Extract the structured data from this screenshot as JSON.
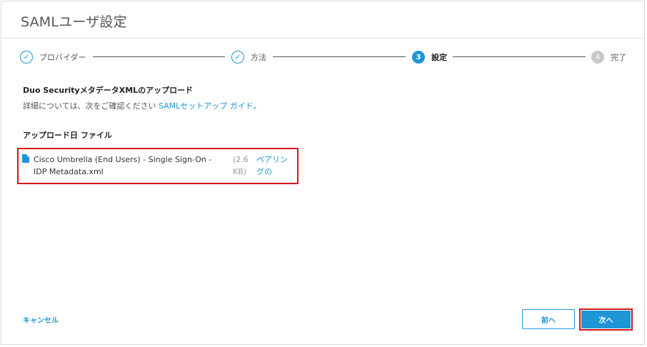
{
  "dialog": {
    "title": "SAMLユーザ設定"
  },
  "stepper": {
    "steps": [
      {
        "label": "プロバイダー",
        "state": "done",
        "marker": "✓"
      },
      {
        "label": "方法",
        "state": "done",
        "marker": "✓"
      },
      {
        "label": "設定",
        "state": "active",
        "marker": "3"
      },
      {
        "label": "完了",
        "state": "todo",
        "marker": "4"
      }
    ]
  },
  "content": {
    "heading": "Duo SecurityメタデータXMLのアップロード",
    "description_prefix": "詳細については、次をご確認ください",
    "description_link": "SAMLセットアップ ガイド。",
    "upload_heading": "アップロード日 ファイル",
    "file": {
      "icon": "file-icon",
      "name": "Cisco Umbrella (End Users) - Single Sign-On - IDP Metadata.xml",
      "size": "(2.6 KB)",
      "link": "ペアリングの"
    }
  },
  "footer": {
    "cancel": "キャンセル",
    "prev": "前へ",
    "next": "次へ"
  },
  "colors": {
    "accent": "#1e96d6",
    "highlight": "#d7141a",
    "inactive_step": "#c9c9c9"
  }
}
